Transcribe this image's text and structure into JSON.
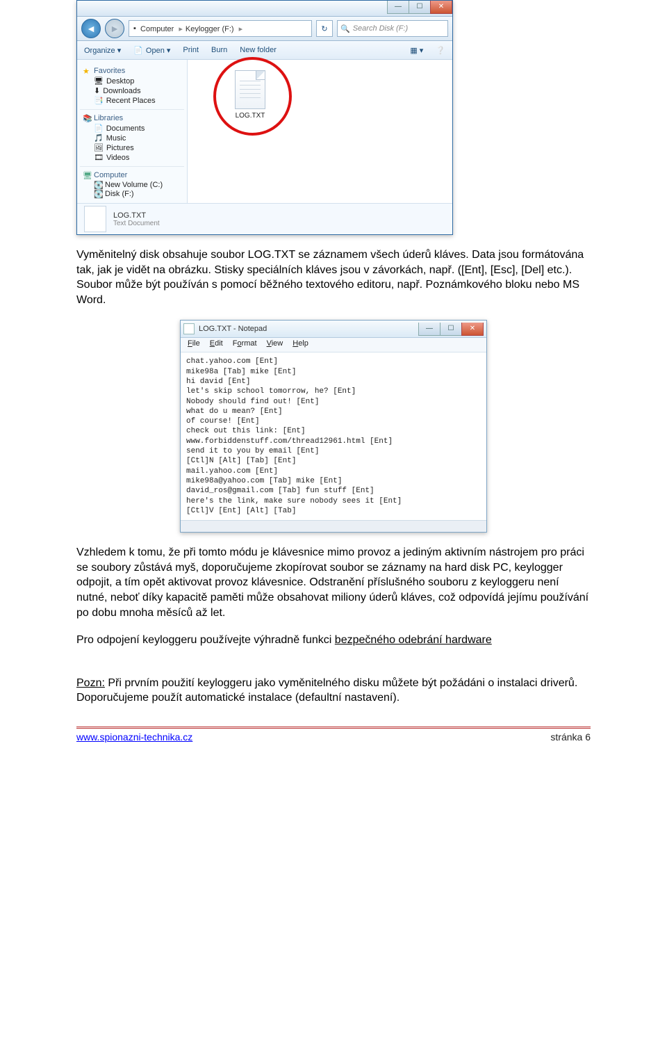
{
  "explorer": {
    "crumb": [
      "Computer",
      "Keylogger (F:)"
    ],
    "search_placeholder": "Search Disk (F:)",
    "toolbar": {
      "organize": "Organize ▾",
      "open": "Open ▾",
      "print": "Print",
      "burn": "Burn",
      "newfolder": "New folder"
    },
    "sidebar": {
      "fav": "Favorites",
      "fav_items": [
        "Desktop",
        "Downloads",
        "Recent Places"
      ],
      "lib": "Libraries",
      "lib_items": [
        "Documents",
        "Music",
        "Pictures",
        "Videos"
      ],
      "comp": "Computer",
      "comp_items": [
        "New Volume (C:)",
        "Disk (F:)"
      ]
    },
    "file_label": "LOG.TXT",
    "details": {
      "name": "LOG.TXT",
      "type": "Text Document"
    }
  },
  "para1": "Vyměnitelný disk obsahuje soubor LOG.TXT se záznamem všech úderů kláves. Data jsou formátována tak, jak je vidět na obrázku. Stisky speciálních kláves jsou v závorkách, např. ([Ent], [Esc], [Del] etc.). Soubor může být používán s pomocí běžného textového editoru, např. Poznámkového bloku nebo MS Word.",
  "notepad": {
    "title": "LOG.TXT - Notepad",
    "menu": [
      "File",
      "Edit",
      "Format",
      "View",
      "Help"
    ],
    "lines": [
      "chat.yahoo.com [Ent]",
      "mike98a [Tab] mike [Ent]",
      "hi david [Ent]",
      "let's skip school tomorrow, he? [Ent]",
      "Nobody should find out! [Ent]",
      "what do u mean? [Ent]",
      "of course! [Ent]",
      "check out this link: [Ent]",
      "www.forbiddenstuff.com/thread12961.html [Ent]",
      "send it to you by email [Ent]",
      "[Ctl]N [Alt] [Tab] [Ent]",
      "mail.yahoo.com [Ent]",
      "mike98a@yahoo.com [Tab] mike [Ent]",
      "david_ros@gmail.com [Tab] fun stuff [Ent]",
      "here's the link, make sure nobody sees it [Ent]",
      "[Ctl]V [Ent] [Alt] [Tab]"
    ]
  },
  "para2": "Vzhledem k tomu, že při tomto módu je klávesnice mimo provoz a jediným aktivním nástrojem pro práci se soubory zůstává myš, doporučujeme zkopírovat soubor se záznamy na hard disk PC, keylogger odpojit, a tím opět aktivovat provoz klávesnice. Odstranění příslušného souboru z keyloggeru není nutné, neboť díky kapacitě paměti může obsahovat miliony úderů kláves, což odpovídá jejímu používání po dobu mnoha měsíců až let.",
  "para3_a": "Pro odpojení keyloggeru používejte výhradně funkci ",
  "para3_link": "bezpečného odebrání hardware",
  "pozn_label": "Pozn:",
  "pozn_text": " Při prvním použití keyloggeru jako vyměnitelného disku můžete být požádáni o instalaci driverů. Doporučujeme použít automatické instalace (defaultní nastavení).",
  "footer": {
    "url": "www.spionazni-technika.cz",
    "page": "stránka 6"
  }
}
